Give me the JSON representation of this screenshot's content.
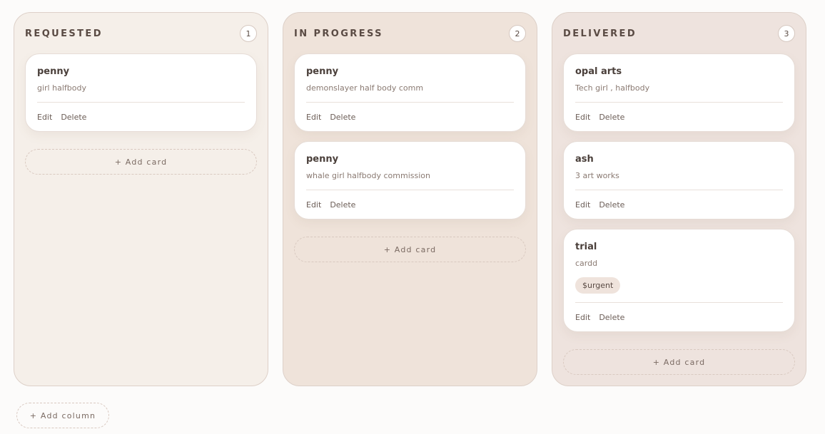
{
  "columns": [
    {
      "title": "REQUESTED",
      "count": "1",
      "cards": [
        {
          "title": "penny",
          "description": "girl halfbody",
          "tag": "",
          "edit_label": "Edit",
          "delete_label": "Delete"
        }
      ],
      "add_card_label": "+ Add card"
    },
    {
      "title": "IN PROGRESS",
      "count": "2",
      "cards": [
        {
          "title": "penny",
          "description": "demonslayer half body comm",
          "tag": "",
          "edit_label": "Edit",
          "delete_label": "Delete"
        },
        {
          "title": "penny",
          "description": "whale girl halfbody commission",
          "tag": "",
          "edit_label": "Edit",
          "delete_label": "Delete"
        }
      ],
      "add_card_label": "+ Add card"
    },
    {
      "title": "DELIVERED",
      "count": "3",
      "cards": [
        {
          "title": "opal arts",
          "description": "Tech girl , halfbody",
          "tag": "",
          "edit_label": "Edit",
          "delete_label": "Delete"
        },
        {
          "title": "ash",
          "description": "3 art works",
          "tag": "",
          "edit_label": "Edit",
          "delete_label": "Delete"
        },
        {
          "title": "trial",
          "description": "cardd",
          "tag": "$urgent",
          "edit_label": "Edit",
          "delete_label": "Delete"
        }
      ],
      "add_card_label": "+ Add card"
    }
  ],
  "add_column_label": "+ Add column",
  "colors": {
    "page_bg": "#fcfbfa",
    "requested_bg": "#f5efe9",
    "in_progress_bg": "#efe3da",
    "delivered_bg": "#eee3de",
    "card_bg": "#ffffff",
    "tag_bg": "#efe3dc",
    "text": "#4a3f3a"
  }
}
